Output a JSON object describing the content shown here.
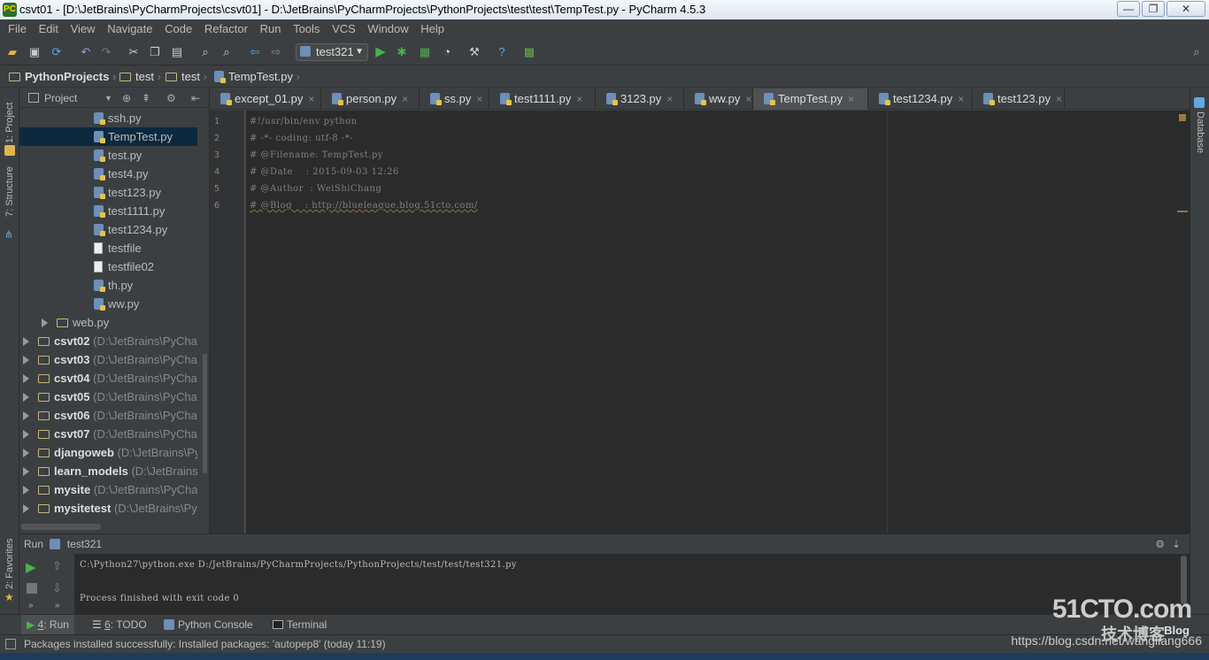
{
  "window": {
    "title": "csvt01 - [D:\\JetBrains\\PyCharmProjects\\csvt01] - D:\\JetBrains\\PyCharmProjects\\PythonProjects\\test\\test\\TempTest.py - PyCharm 4.5.3",
    "minimize": "—",
    "maximize": "❐",
    "close": "✕"
  },
  "menu": [
    "File",
    "Edit",
    "View",
    "Navigate",
    "Code",
    "Refactor",
    "Run",
    "Tools",
    "VCS",
    "Window",
    "Help"
  ],
  "toolbar": {
    "run_config": "test321",
    "icons": [
      "open-folder-icon",
      "save-icon",
      "sync-icon",
      "undo-icon",
      "redo-icon",
      "cut-icon",
      "copy-icon",
      "paste-icon",
      "find-icon",
      "replace-icon",
      "back-icon",
      "forward-icon",
      "run-icon",
      "debug-icon",
      "coverage-icon",
      "profile-icon",
      "settings-icon",
      "help-icon",
      "python-console-icon"
    ]
  },
  "breadcrumbs": [
    "PythonProjects",
    "test",
    "test",
    "TempTest.py"
  ],
  "project_panel": {
    "header": "Project",
    "tree": [
      {
        "label": "ssh.py",
        "type": "py"
      },
      {
        "label": "TempTest.py",
        "type": "py",
        "selected": true
      },
      {
        "label": "test.py",
        "type": "py"
      },
      {
        "label": "test4.py",
        "type": "py"
      },
      {
        "label": "test123.py",
        "type": "py"
      },
      {
        "label": "test1111.py",
        "type": "py"
      },
      {
        "label": "test1234.py",
        "type": "py"
      },
      {
        "label": "testfile",
        "type": "txt"
      },
      {
        "label": "testfile02",
        "type": "txt"
      },
      {
        "label": "th.py",
        "type": "py"
      },
      {
        "label": "ww.py",
        "type": "py"
      },
      {
        "label": "web.py",
        "type": "folder"
      },
      {
        "label": "csvt02",
        "path": "(D:\\JetBrains\\PyChar",
        "type": "project"
      },
      {
        "label": "csvt03",
        "path": "(D:\\JetBrains\\PyChar",
        "type": "project"
      },
      {
        "label": "csvt04",
        "path": "(D:\\JetBrains\\PyChar",
        "type": "project"
      },
      {
        "label": "csvt05",
        "path": "(D:\\JetBrains\\PyChar",
        "type": "project"
      },
      {
        "label": "csvt06",
        "path": "(D:\\JetBrains\\PyChar",
        "type": "project"
      },
      {
        "label": "csvt07",
        "path": "(D:\\JetBrains\\PyChar",
        "type": "project"
      },
      {
        "label": "djangoweb",
        "path": "(D:\\JetBrains\\Py",
        "type": "project"
      },
      {
        "label": "learn_models",
        "path": "(D:\\JetBrains'",
        "type": "project"
      },
      {
        "label": "mysite",
        "path": "(D:\\JetBrains\\PyChar",
        "type": "project"
      },
      {
        "label": "mysitetest",
        "path": "(D:\\JetBrains\\Py",
        "type": "project"
      }
    ]
  },
  "side_tabs": {
    "left": [
      "1: Project",
      "7: Structure",
      "2: Favorites"
    ],
    "right": [
      "Database"
    ]
  },
  "editor_tabs": [
    "except_01.py",
    "person.py",
    "ss.py",
    "test1111.py",
    "3123.py",
    "ww.py",
    "TempTest.py",
    "test1234.py",
    "test123.py"
  ],
  "active_tab": "TempTest.py",
  "code_lines": [
    "#!/usr/bin/env python",
    "# -*- coding: utf-8 -*-",
    "# @Filename: TempTest.py",
    "# @Date    : 2015-09-03 12:26",
    "# @Author  : WeiShiChang",
    "# @Blog    : http://blueleague.blog.51cto.com/"
  ],
  "line_numbers": [
    "1",
    "2",
    "3",
    "4",
    "5",
    "6"
  ],
  "run_panel": {
    "label": "Run",
    "config": "test321",
    "output": [
      "C:\\Python27\\python.exe D:/JetBrains/PyCharmProjects/PythonProjects/test/test/test321.py",
      "",
      "Process finished with exit code 0"
    ]
  },
  "bottom_tabs": [
    {
      "num": "4",
      "label": ": Run",
      "active": true
    },
    {
      "num": "6",
      "label": ": TODO",
      "active": false
    },
    {
      "num": "",
      "label": "Python Console",
      "active": false
    },
    {
      "num": "",
      "label": "Terminal",
      "active": false
    }
  ],
  "status": "Packages installed successfully: Installed packages: 'autopep8' (today 11:19)",
  "watermark": "https://blog.csdn.net/wangliang666",
  "logo": {
    "main": "51CTO.com",
    "sub": "技术博客",
    "blog": "Blog"
  }
}
